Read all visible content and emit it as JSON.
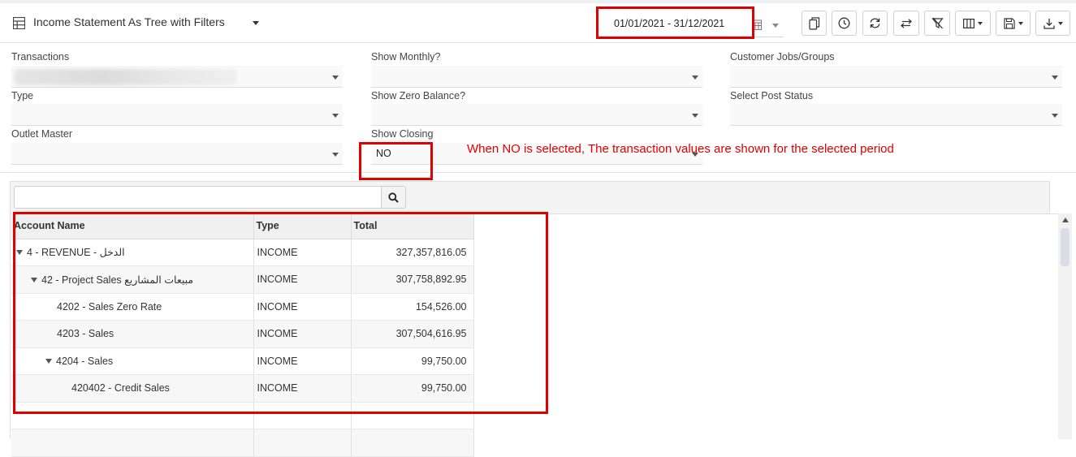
{
  "header": {
    "title": "Income Statement As Tree with Filters",
    "date_range": "01/01/2021 - 31/12/2021",
    "icons": [
      "copy-icon",
      "clock-icon",
      "refresh-icon",
      "swap-icon",
      "clear-filter-icon",
      "columns-icon",
      "save-icon",
      "download-icon"
    ]
  },
  "filters": {
    "transactions_label": "Transactions",
    "show_monthly_label": "Show Monthly?",
    "customer_jobs_label": "Customer Jobs/Groups",
    "type_label": "Type",
    "show_zero_balance_label": "Show Zero Balance?",
    "select_post_status_label": "Select Post Status",
    "outlet_master_label": "Outlet Master",
    "show_closing_label": "Show Closing",
    "show_closing_value": "NO"
  },
  "annotation": {
    "note": "When NO is selected, The transaction values are shown for the selected period",
    "color": "#e00000"
  },
  "grid": {
    "search_placeholder": "",
    "columns": [
      "Account Name",
      "Type",
      "Total"
    ],
    "rows": [
      {
        "name": "4 - REVENUE - الدخل",
        "type": "INCOME",
        "total": "327,357,816.05"
      },
      {
        "name": "42 - Project Sales مبيعات المشاريع",
        "type": "INCOME",
        "total": "307,758,892.95"
      },
      {
        "name": "4202 - Sales Zero Rate",
        "type": "INCOME",
        "total": "154,526.00"
      },
      {
        "name": "4203 - Sales",
        "type": "INCOME",
        "total": "307,504,616.95"
      },
      {
        "name": "4204 - Sales",
        "type": "INCOME",
        "total": "99,750.00"
      },
      {
        "name": "420402 - Credit Sales",
        "type": "INCOME",
        "total": "99,750.00"
      },
      {
        "name": "",
        "type": "",
        "total": ""
      },
      {
        "name": "",
        "type": "",
        "total": ""
      }
    ]
  }
}
